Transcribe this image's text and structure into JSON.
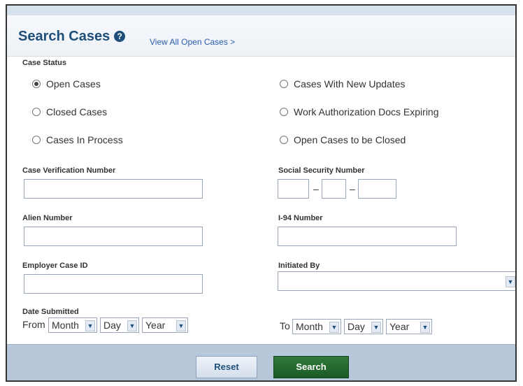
{
  "header": {
    "title": "Search Cases",
    "help_icon": "?",
    "view_all_link": "View All Open Cases >"
  },
  "case_status": {
    "label": "Case Status",
    "options_left": [
      "Open Cases",
      "Closed Cases",
      "Cases In Process"
    ],
    "options_right": [
      "Cases With New Updates",
      "Work Authorization Docs Expiring",
      "Open Cases to be Closed"
    ],
    "selected": "Open Cases"
  },
  "fields": {
    "case_verification_number": {
      "label": "Case Verification Number",
      "value": ""
    },
    "social_security_number": {
      "label": "Social Security Number",
      "separator": "–"
    },
    "alien_number": {
      "label": "Alien Number",
      "value": ""
    },
    "i94_number": {
      "label": "I-94 Number",
      "value": ""
    },
    "employer_case_id": {
      "label": "Employer Case ID",
      "value": ""
    },
    "initiated_by": {
      "label": "Initiated By",
      "value": ""
    }
  },
  "date_submitted": {
    "label": "Date Submitted",
    "from_label": "From",
    "to_label": "To",
    "month": "Month",
    "day": "Day",
    "year": "Year"
  },
  "buttons": {
    "reset": "Reset",
    "search": "Search"
  },
  "icons": {
    "dropdown": "chevron-down-icon"
  },
  "colors": {
    "title": "#1f4e79",
    "link": "#2a5db0",
    "footer": "#b7c8db",
    "search_button": "#1c5a27"
  }
}
